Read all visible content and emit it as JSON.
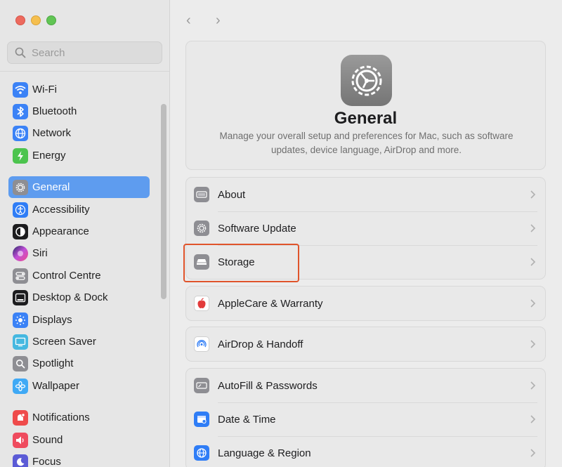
{
  "sidebar": {
    "search_placeholder": "Search",
    "groups": [
      [
        {
          "label": "Wi-Fi",
          "icon": "wifi-icon",
          "color": "#3b82f6"
        },
        {
          "label": "Bluetooth",
          "icon": "bluetooth-icon",
          "color": "#3b82f6"
        },
        {
          "label": "Network",
          "icon": "network-globe-icon",
          "color": "#3b82f6"
        },
        {
          "label": "Energy",
          "icon": "energy-bolt-icon",
          "color": "#4cc44e"
        }
      ],
      [
        {
          "label": "General",
          "icon": "gear-icon",
          "color": "#8e8e93",
          "selected": true
        },
        {
          "label": "Accessibility",
          "icon": "accessibility-icon",
          "color": "#2f7df6"
        },
        {
          "label": "Appearance",
          "icon": "appearance-icon",
          "color": "#1c1c1e"
        },
        {
          "label": "Siri",
          "icon": "siri-icon",
          "color": "#c24fd8"
        },
        {
          "label": "Control Centre",
          "icon": "control-centre-icon",
          "color": "#8e8e93"
        },
        {
          "label": "Desktop & Dock",
          "icon": "desktop-dock-icon",
          "color": "#1c1c1e"
        },
        {
          "label": "Displays",
          "icon": "displays-icon",
          "color": "#3b82f6"
        },
        {
          "label": "Screen Saver",
          "icon": "screen-saver-icon",
          "color": "#45b8e0"
        },
        {
          "label": "Spotlight",
          "icon": "spotlight-icon",
          "color": "#8e8e93"
        },
        {
          "label": "Wallpaper",
          "icon": "wallpaper-icon",
          "color": "#3fa9f5"
        }
      ],
      [
        {
          "label": "Notifications",
          "icon": "notifications-icon",
          "color": "#ef4b4b"
        },
        {
          "label": "Sound",
          "icon": "sound-icon",
          "color": "#ef4b5e"
        },
        {
          "label": "Focus",
          "icon": "focus-icon",
          "color": "#5b5bd6"
        }
      ]
    ]
  },
  "main": {
    "back_glyph": "‹",
    "forward_glyph": "›",
    "title": "General",
    "description": "Manage your overall setup and preferences for Mac, such as software updates, device language, AirDrop and more.",
    "groups": [
      [
        {
          "label": "About",
          "icon": "about-icon",
          "color": "#8e8e93"
        },
        {
          "label": "Software Update",
          "icon": "software-update-icon",
          "color": "#8e8e93"
        },
        {
          "label": "Storage",
          "icon": "storage-icon",
          "color": "#8e8e93"
        }
      ],
      [
        {
          "label": "AppleCare & Warranty",
          "icon": "apple-icon",
          "color": "#ffffff"
        }
      ],
      [
        {
          "label": "AirDrop & Handoff",
          "icon": "airdrop-icon",
          "color": "#ffffff"
        }
      ],
      [
        {
          "label": "AutoFill & Passwords",
          "icon": "autofill-icon",
          "color": "#8e8e93"
        },
        {
          "label": "Date & Time",
          "icon": "date-time-icon",
          "color": "#2f7df6"
        },
        {
          "label": "Language & Region",
          "icon": "language-region-icon",
          "color": "#2f7df6"
        }
      ]
    ]
  },
  "highlight_color": "#e0542b"
}
